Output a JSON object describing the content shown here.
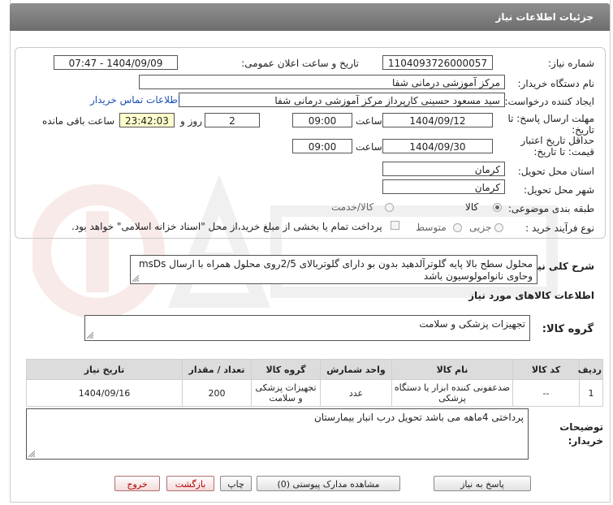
{
  "header": {
    "title": "جزئیات اطلاعات نیاز"
  },
  "form": {
    "need_number": {
      "label": "شماره نیاز:",
      "value": "1104093726000057"
    },
    "announce_datetime": {
      "label": "تاریخ و ساعت اعلان عمومی:",
      "value": "1404/09/09 - 07:47"
    },
    "buyer_org": {
      "label": "نام دستگاه خریدار:",
      "value": "مرکز آموزشی درمانی شفا"
    },
    "creator": {
      "label": "ایجاد کننده درخواست:",
      "value": "سید مسعود حسینی کارپرداز مرکز آموزشی درمانی شفا",
      "contact_link": "اطلاعات تماس خریدار"
    },
    "reply_deadline": {
      "label": "مهلت ارسال پاسخ: تا تاریخ:",
      "date": "1404/09/12",
      "time_label": "ساعت",
      "time": "09:00",
      "days": "2",
      "days_label": "روز و",
      "remaining": "23:42:03",
      "remaining_label": "ساعت باقی مانده"
    },
    "price_validity": {
      "label": "حداقل تاریخ اعتبار قیمت: تا تاریخ:",
      "date": "1404/09/30",
      "time_label": "ساعت",
      "time": "09:00"
    },
    "province": {
      "label": "استان محل تحویل:",
      "value": "کرمان"
    },
    "city": {
      "label": "شهر محل تحویل:",
      "value": "کرمان"
    },
    "category": {
      "label": "طبقه بندی موضوعی:",
      "options": [
        "کالا",
        "کالا/خدمت"
      ],
      "selected": "کالا"
    },
    "process_type": {
      "label": "نوع فرآیند خرید :",
      "options": [
        "جزیی",
        "متوسط"
      ],
      "payment_note": "پرداخت تمام یا بخشی از مبلغ خرید،از محل \"اسناد خزانه اسلامی\" خواهد بود."
    },
    "description": {
      "label": "شرح کلی نیاز:",
      "value": "محلول سطح بالا پایه گلوترآلدهید بدون بو دارای گلوتربالای 2/5روی محلول همراه با ارسال msDs وحاوی نانوامولوسیون باشد"
    }
  },
  "goods": {
    "section_title": "اطلاعات کالاهای مورد نیاز",
    "group_label": "گروه کالا:",
    "group_value": "تجهیزات پزشکی و سلامت",
    "columns": [
      "ردیف",
      "کد کالا",
      "نام کالا",
      "واحد شمارش",
      "گروه کالا",
      "تعداد / مقدار",
      "تاریخ نیاز"
    ],
    "rows": [
      [
        "1",
        "--",
        "ضدعفونی کننده ابزار یا دستگاه پزشکی",
        "عدد",
        "تجهیزات پزشکی و سلامت",
        "200",
        "1404/09/16"
      ]
    ]
  },
  "buyer_notes": {
    "label": "توضیحات خریدار:",
    "value": "پرداختی  4ماهه می باشد تحویل درب انبار بیمارستان"
  },
  "buttons": {
    "reply": "پاسخ به نیاز",
    "attachments": "مشاهده مدارک پیوستی (0)",
    "print": "چاپ",
    "back": "بازگشت",
    "exit": "خروج"
  }
}
